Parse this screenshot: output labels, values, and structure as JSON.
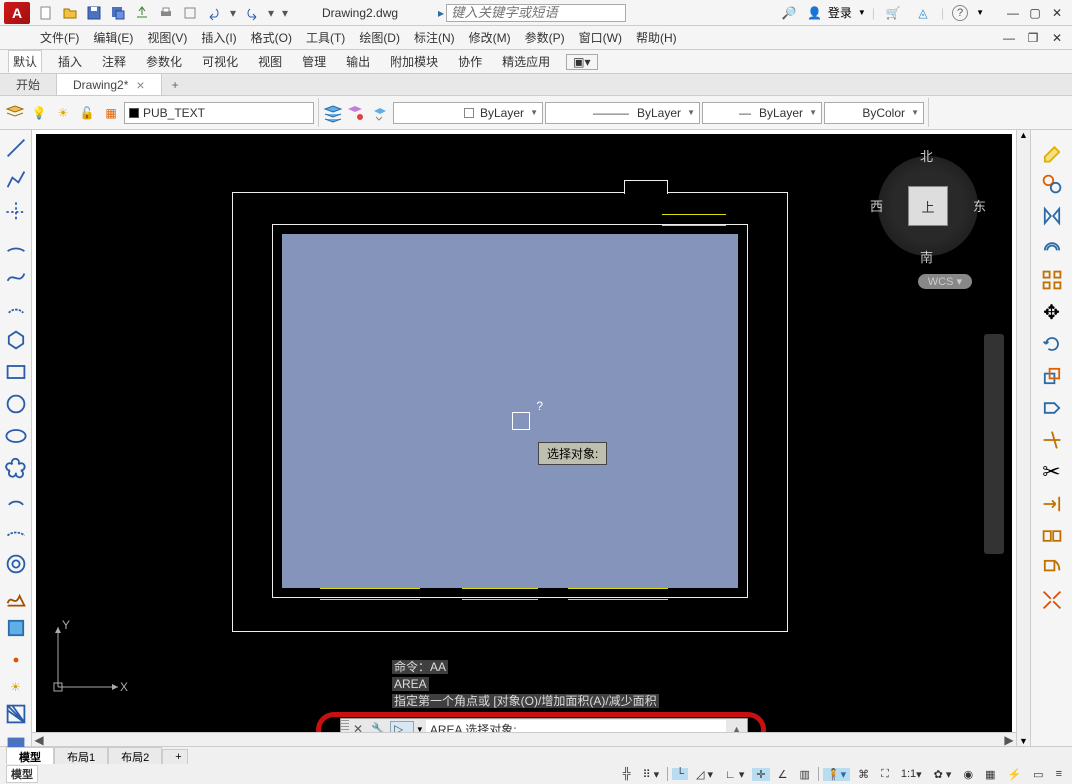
{
  "app": {
    "logo": "A"
  },
  "titlebar": {
    "filename": "Drawing2.dwg",
    "search_placeholder": "键入关键字或短语",
    "login": "登录"
  },
  "menus": [
    "文件(F)",
    "编辑(E)",
    "视图(V)",
    "插入(I)",
    "格式(O)",
    "工具(T)",
    "绘图(D)",
    "标注(N)",
    "修改(M)",
    "参数(P)",
    "窗口(W)",
    "帮助(H)"
  ],
  "ribbon_tabs": [
    "默认",
    "插入",
    "注释",
    "参数化",
    "可视化",
    "视图",
    "管理",
    "输出",
    "附加模块",
    "协作",
    "精选应用"
  ],
  "active_ribbon_tab": 0,
  "doc_tabs": [
    {
      "label": "开始",
      "active": false,
      "closable": false
    },
    {
      "label": "Drawing2*",
      "active": true,
      "closable": true
    }
  ],
  "layer": {
    "name": "PUB_TEXT"
  },
  "bylayer": {
    "linetype": "ByLayer",
    "lineweight": "ByLayer",
    "color": "ByLayer",
    "plotstyle": "ByColor"
  },
  "tooltip": "选择对象:",
  "viewcube": {
    "up": "上",
    "n": "北",
    "s": "南",
    "e": "东",
    "w": "西"
  },
  "wcs": "WCS",
  "cmd_history": {
    "l1": "命令：AA",
    "l2": "AREA",
    "l3": "指定第一个角点或 [对象(O)/增加面积(A)/减少面积"
  },
  "cmdline": {
    "prompt": "AREA 选择对象:"
  },
  "layout_tabs": [
    "模型",
    "布局1",
    "布局2"
  ],
  "statusbar": {
    "model": "模型",
    "scale": "1:1"
  },
  "axes": {
    "x": "X",
    "y": "Y"
  }
}
